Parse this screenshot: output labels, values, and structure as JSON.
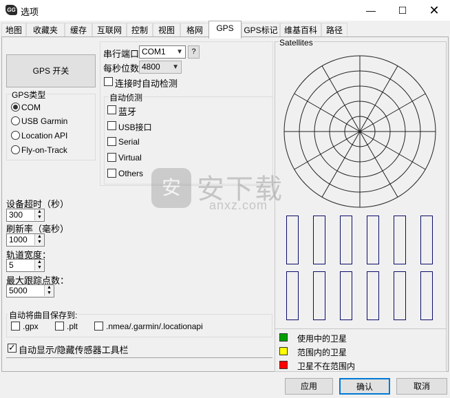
{
  "window": {
    "title": "选项",
    "icon_text": "GG",
    "minimize_glyph": "—",
    "maximize_glyph": "☐",
    "close_glyph": "✕"
  },
  "tabs": [
    {
      "label": "地图"
    },
    {
      "label": "收藏夹"
    },
    {
      "label": "缓存"
    },
    {
      "label": "互联网"
    },
    {
      "label": "控制"
    },
    {
      "label": "视图"
    },
    {
      "label": "格网"
    },
    {
      "label": "GPS"
    },
    {
      "label": "GPS标记"
    },
    {
      "label": "维基百科"
    },
    {
      "label": "路径"
    }
  ],
  "active_tab": "GPS",
  "gps_toggle": {
    "label": "GPS 开关"
  },
  "gps_type": {
    "title": "GPS类型",
    "options": [
      {
        "label": "COM",
        "checked": true
      },
      {
        "label": "USB Garmin",
        "checked": false
      },
      {
        "label": "Location API",
        "checked": false
      },
      {
        "label": "Fly-on-Track",
        "checked": false
      }
    ]
  },
  "serial": {
    "port_label": "串行端口",
    "port_value": "COM1",
    "help_label": "?",
    "baud_label": "每秒位数",
    "baud_value": "4800",
    "auto_detect_on_connect": "连接时自动检测"
  },
  "auto_detect": {
    "title": "自动侦测",
    "items": [
      {
        "label": "蓝牙",
        "checked": false
      },
      {
        "label": "USB接口",
        "checked": false
      },
      {
        "label": "Serial",
        "checked": false
      },
      {
        "label": "Virtual",
        "checked": false
      },
      {
        "label": "Others",
        "checked": false
      }
    ]
  },
  "device_timeout": {
    "label": "设备超时（秒）",
    "value": "300"
  },
  "refresh_rate": {
    "label": "刷新率（毫秒）",
    "value": "1000"
  },
  "track_width": {
    "label": "轨道宽度：",
    "value": "5"
  },
  "max_track_points": {
    "label": "最大跟踪点数：",
    "value": "5000"
  },
  "auto_save": {
    "title": "自动将曲目保存到:",
    "options": [
      {
        "label": ".gpx",
        "checked": false
      },
      {
        "label": ".plt",
        "checked": false
      },
      {
        "label": ".nmea/.garmin/.locationapi",
        "checked": false
      }
    ]
  },
  "sensor_toolbar": {
    "label": "自动显示/隐藏传感器工具栏",
    "checked": true
  },
  "satellites": {
    "title": "Satellites",
    "legend": [
      {
        "label": "使用中的卫星",
        "color": "#00a000"
      },
      {
        "label": "范围内的卫星",
        "color": "#ffff00"
      },
      {
        "label": "卫星不在范围内",
        "color": "#ff0000"
      }
    ]
  },
  "watermark": {
    "text_cn": "安下载",
    "text_en": "anxz.com",
    "badge": "安"
  },
  "footer": {
    "apply": "应用",
    "ok": "确认",
    "cancel": "取消"
  }
}
